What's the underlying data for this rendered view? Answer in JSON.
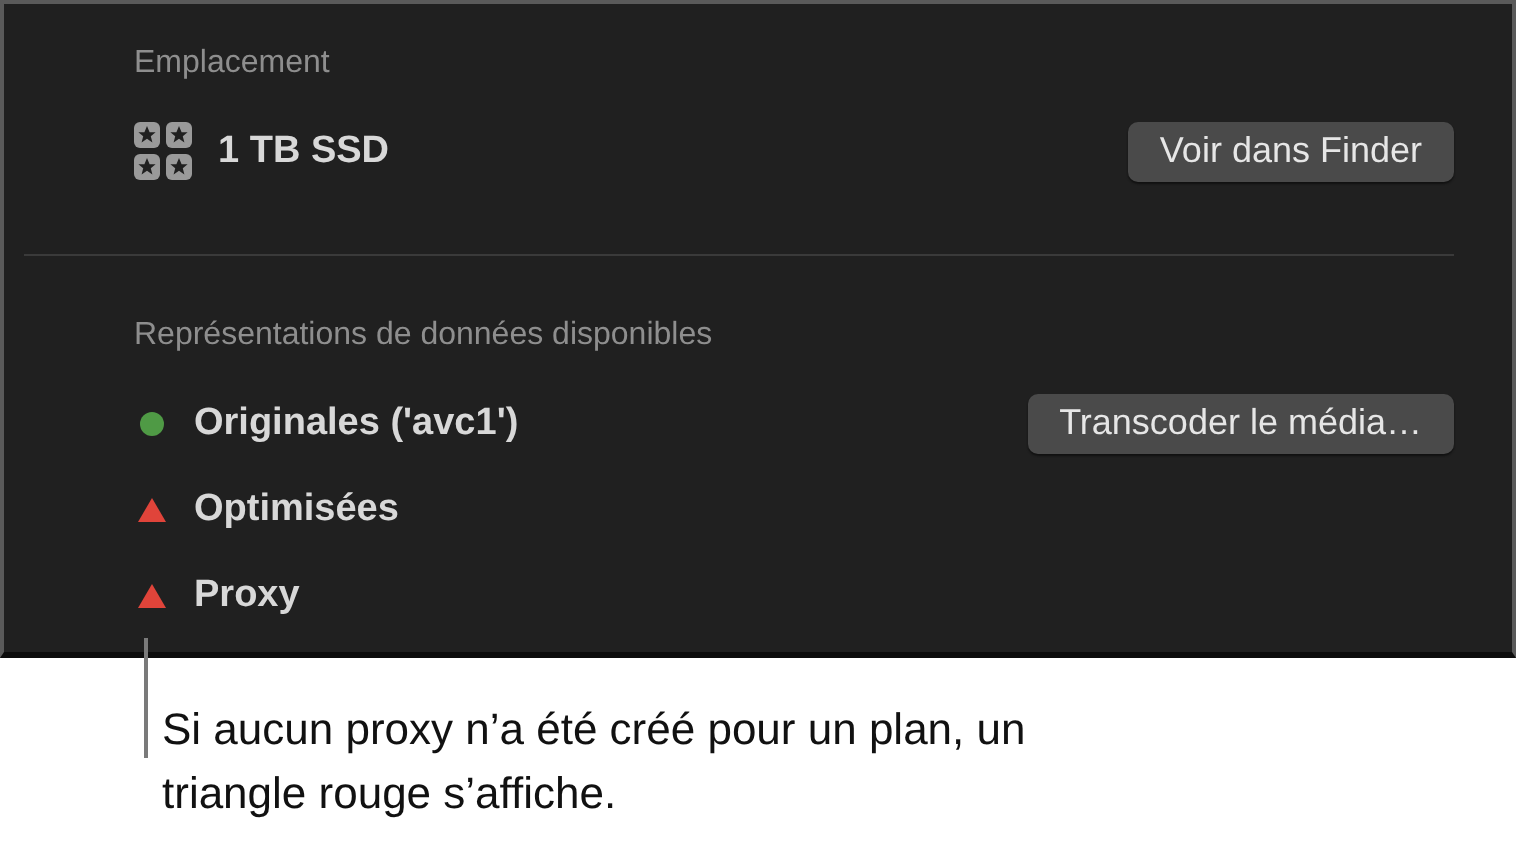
{
  "location": {
    "label": "Emplacement",
    "drive": "1 TB SSD",
    "button": "Voir dans Finder"
  },
  "representations": {
    "label": "Représentations de données disponibles",
    "button": "Transcoder le média…",
    "items": [
      {
        "name": "Originales ('avc1')",
        "kind": "available"
      },
      {
        "name": "Optimisées",
        "kind": "missing"
      },
      {
        "name": "Proxy",
        "kind": "missing"
      }
    ]
  },
  "callout": "Si aucun proxy n’a été créé pour un plan, un triangle rouge s’affiche."
}
